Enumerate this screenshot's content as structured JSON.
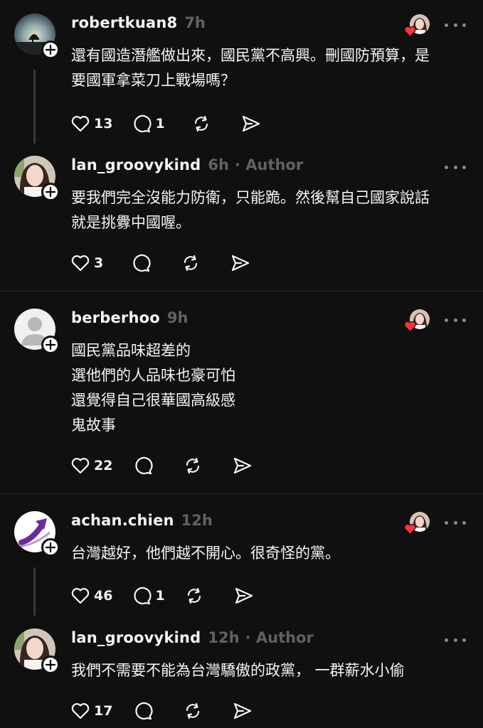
{
  "posts": [
    {
      "username": "robertkuan8",
      "time": "7h",
      "author_tag": "",
      "lines": [
        "還有國造潛艦做出來，國民黨不高興。刪國防預算，是",
        "要國軍拿菜刀上戰場嗎？"
      ],
      "likes": "13",
      "replies": "1",
      "liked_by_author": true,
      "avatar": "landscape-avatar"
    },
    {
      "username": "lan_groovykind",
      "time": "6h",
      "author_tag": "· Author",
      "lines": [
        "要我們完全沒能力防衛，只能跪。然後幫自己國家說話",
        "就是挑釁中國喔。"
      ],
      "likes": "3",
      "replies": "",
      "liked_by_author": false,
      "avatar": "woman-avatar"
    },
    {
      "username": "berberhoo",
      "time": "9h",
      "author_tag": "",
      "lines": [
        "國民黨品味超差的",
        "選他們的人品味也豪可怕",
        "還覺得自己很華國高級感",
        "鬼故事"
      ],
      "likes": "22",
      "replies": "",
      "liked_by_author": true,
      "avatar": "default-avatar"
    },
    {
      "username": "achan.chien",
      "time": "12h",
      "author_tag": "",
      "lines": [
        "台灣越好，他們越不開心。很奇怪的黨。"
      ],
      "likes": "46",
      "replies": "1",
      "liked_by_author": true,
      "avatar": "arrow-logo-avatar"
    },
    {
      "username": "lan_groovykind",
      "time": "12h",
      "author_tag": "· Author",
      "lines": [
        "我們不需要不能為台灣驕傲的政黨， 一群薪水小偷"
      ],
      "likes": "17",
      "replies": "",
      "liked_by_author": false,
      "avatar": "woman-avatar"
    }
  ],
  "colors": {
    "background": "#101010",
    "text": "#f3f5f7",
    "muted": "#616161",
    "heart": "#ff3040"
  }
}
